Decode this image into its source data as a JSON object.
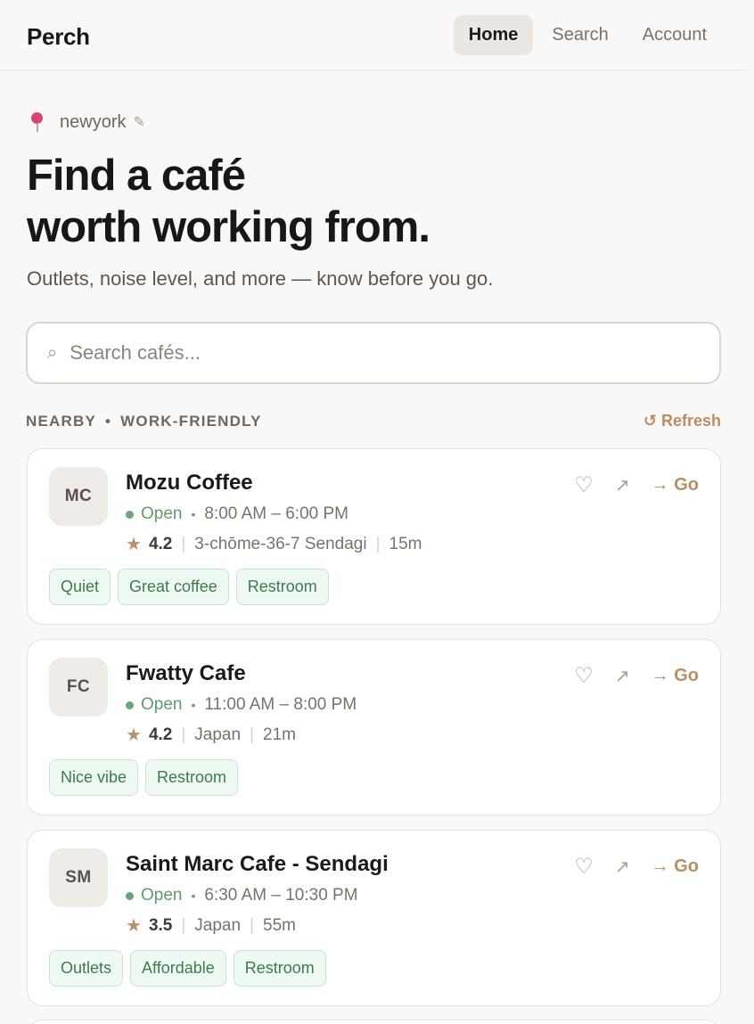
{
  "app": {
    "brand": "Perch"
  },
  "nav": [
    {
      "label": "Home",
      "active": true
    },
    {
      "label": "Search",
      "active": false
    },
    {
      "label": "Account",
      "active": false
    }
  ],
  "location": {
    "city": "newyork",
    "pin_icon": "map-pin-icon",
    "edit_icon": "pencil-icon"
  },
  "hero": {
    "line1": "Find a café",
    "line2": "worth working from."
  },
  "subtitle": "Outlets, noise level, and more — know before you go.",
  "search": {
    "placeholder": "Search cafés...",
    "value": "",
    "icon": "search-icon"
  },
  "section": {
    "left": "NEARBY",
    "dot": "•",
    "right": "WORK-FRIENDLY",
    "refresh_label": "↺ Refresh"
  },
  "cards": [
    {
      "initials": "MC",
      "name": "Mozu Coffee",
      "status": "Open",
      "hours": "8:00 AM – 6:00 PM",
      "rating": "4.2",
      "address": "3-chōme-36-7 Sendagi",
      "distance": "15m",
      "tags": [
        "Quiet",
        "Great coffee",
        "Restroom"
      ],
      "go_label": "→ Go"
    },
    {
      "initials": "FC",
      "name": "Fwatty Cafe",
      "status": "Open",
      "hours": "11:00 AM – 8:00 PM",
      "rating": "4.2",
      "address": "Japan",
      "distance": "21m",
      "tags": [
        "Nice vibe",
        "Restroom"
      ],
      "go_label": "→ Go"
    },
    {
      "initials": "SM",
      "name": "Saint Marc Cafe - Sendagi",
      "status": "Open",
      "hours": "6:30 AM – 10:30 PM",
      "rating": "3.5",
      "address": "Japan",
      "distance": "55m",
      "tags": [
        "Outlets",
        "Affordable",
        "Restroom"
      ],
      "go_label": "→ Go"
    }
  ],
  "colors": {
    "background": "#f9f8f6",
    "accent": "#b88e63",
    "open_green": "#5f9a6e",
    "tag_bg": "#eefaf1"
  }
}
